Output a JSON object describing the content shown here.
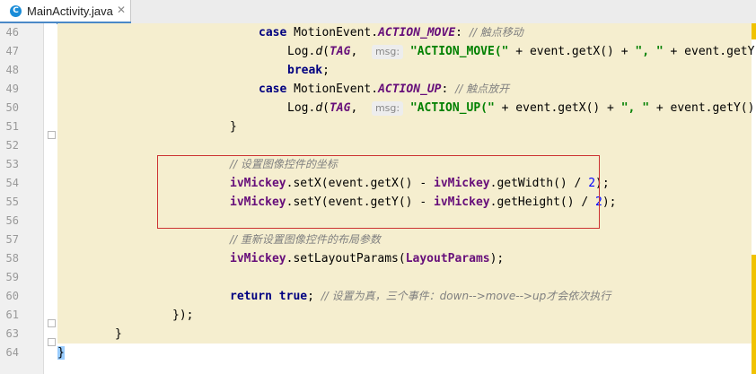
{
  "tab": {
    "title": "MainActivity.java",
    "icon": "c-class-icon",
    "icon_letter": "C",
    "close": "✕"
  },
  "colors": {
    "region_bg": "#f5eecf",
    "deep_bg": "#fbf8e9",
    "redbox": "#cc3333"
  },
  "lines": [
    {
      "num": "46",
      "indent": 28,
      "bg": 224,
      "tokens": [
        {
          "t": "case ",
          "c": "kw"
        },
        {
          "t": "MotionEvent.",
          "c": "cls"
        },
        {
          "t": "ACTION_MOVE",
          "c": "const"
        },
        {
          "t": ": ",
          "c": "cls"
        },
        {
          "t": "// 触点移动",
          "c": "cm"
        }
      ]
    },
    {
      "num": "47",
      "indent": 32,
      "bg": 256,
      "tokens": [
        {
          "t": "Log.",
          "c": "cls"
        },
        {
          "t": "d",
          "c": "mth"
        },
        {
          "t": "(",
          "c": "cls"
        },
        {
          "t": "TAG",
          "c": "const"
        },
        {
          "t": ",  ",
          "c": "cls"
        },
        {
          "t": "msg:",
          "c": "hint"
        },
        {
          "t": " ",
          "c": "cls"
        },
        {
          "t": "\"ACTION_MOVE(\"",
          "c": "str"
        },
        {
          "t": " + event.getX() + ",
          "c": "cls"
        },
        {
          "t": "\", \"",
          "c": "str"
        },
        {
          "t": " + event.getY() + ",
          "c": "cls"
        },
        {
          "t": "\")\"",
          "c": "str"
        },
        {
          "t": ");",
          "c": "cls"
        }
      ]
    },
    {
      "num": "48",
      "indent": 32,
      "bg": 256,
      "tokens": [
        {
          "t": "break",
          "c": "kw"
        },
        {
          "t": ";",
          "c": "cls"
        }
      ]
    },
    {
      "num": "49",
      "indent": 28,
      "bg": 224,
      "tokens": [
        {
          "t": "case ",
          "c": "kw"
        },
        {
          "t": "MotionEvent.",
          "c": "cls"
        },
        {
          "t": "ACTION_UP",
          "c": "const"
        },
        {
          "t": ": ",
          "c": "cls"
        },
        {
          "t": "// 触点放开",
          "c": "cm"
        }
      ]
    },
    {
      "num": "50",
      "indent": 32,
      "bg": 256,
      "tokens": [
        {
          "t": "Log.",
          "c": "cls"
        },
        {
          "t": "d",
          "c": "mth"
        },
        {
          "t": "(",
          "c": "cls"
        },
        {
          "t": "TAG",
          "c": "const"
        },
        {
          "t": ",  ",
          "c": "cls"
        },
        {
          "t": "msg:",
          "c": "hint"
        },
        {
          "t": " ",
          "c": "cls"
        },
        {
          "t": "\"ACTION_UP(\"",
          "c": "str"
        },
        {
          "t": " + event.getX() + ",
          "c": "cls"
        },
        {
          "t": "\", \"",
          "c": "str"
        },
        {
          "t": " + event.getY() + ",
          "c": "cls"
        },
        {
          "t": "\")\"",
          "c": "str"
        },
        {
          "t": ");",
          "c": "cls"
        }
      ]
    },
    {
      "num": "51",
      "indent": 24,
      "bg": 192,
      "tokens": [
        {
          "t": "}",
          "c": "cls"
        }
      ]
    },
    {
      "num": "52",
      "indent": 0,
      "bg": 192,
      "tokens": []
    },
    {
      "num": "53",
      "indent": 24,
      "bg": 192,
      "tokens": [
        {
          "t": "// 设置图像控件的坐标",
          "c": "cm"
        }
      ]
    },
    {
      "num": "54",
      "indent": 24,
      "bg": 192,
      "tokens": [
        {
          "t": "ivMickey",
          "c": "fld"
        },
        {
          "t": ".setX(event.getX() - ",
          "c": "cls"
        },
        {
          "t": "ivMickey",
          "c": "fld"
        },
        {
          "t": ".getWidth() / ",
          "c": "cls"
        },
        {
          "t": "2",
          "c": "num"
        },
        {
          "t": ");",
          "c": "cls"
        }
      ]
    },
    {
      "num": "55",
      "indent": 24,
      "bg": 192,
      "tokens": [
        {
          "t": "ivMickey",
          "c": "fld"
        },
        {
          "t": ".setY(event.getY() - ",
          "c": "cls"
        },
        {
          "t": "ivMickey",
          "c": "fld"
        },
        {
          "t": ".getHeight() / ",
          "c": "cls"
        },
        {
          "t": "2",
          "c": "num"
        },
        {
          "t": ");",
          "c": "cls"
        }
      ]
    },
    {
      "num": "56",
      "indent": 0,
      "bg": 192,
      "tokens": []
    },
    {
      "num": "57",
      "indent": 24,
      "bg": 192,
      "tokens": [
        {
          "t": "// 重新设置图像控件的布局参数",
          "c": "cm"
        }
      ]
    },
    {
      "num": "58",
      "indent": 24,
      "bg": 192,
      "tokens": [
        {
          "t": "ivMickey",
          "c": "fld"
        },
        {
          "t": ".setLayoutParams(",
          "c": "cls"
        },
        {
          "t": "LayoutParams",
          "c": "fld"
        },
        {
          "t": ");",
          "c": "cls"
        }
      ]
    },
    {
      "num": "59",
      "indent": 0,
      "bg": 192,
      "tokens": []
    },
    {
      "num": "60",
      "indent": 24,
      "bg": 192,
      "tokens": [
        {
          "t": "return ",
          "c": "kw"
        },
        {
          "t": "true",
          "c": "kw"
        },
        {
          "t": "; ",
          "c": "cls"
        },
        {
          "t": "// 设置为真，三个事件：down-->move-->up才会依次执行",
          "c": "cm"
        }
      ]
    },
    {
      "num": "61",
      "indent": 16,
      "bg": 128,
      "tokens": [
        {
          "t": "});",
          "c": "cls"
        }
      ]
    },
    {
      "num": "63",
      "indent": 8,
      "bg": 64,
      "tokens": [
        {
          "t": "}",
          "c": "cls"
        }
      ]
    },
    {
      "num": "64",
      "indent": 0,
      "bg": 0,
      "tokens": [
        {
          "t": "}",
          "c": "bracehl"
        }
      ]
    }
  ]
}
